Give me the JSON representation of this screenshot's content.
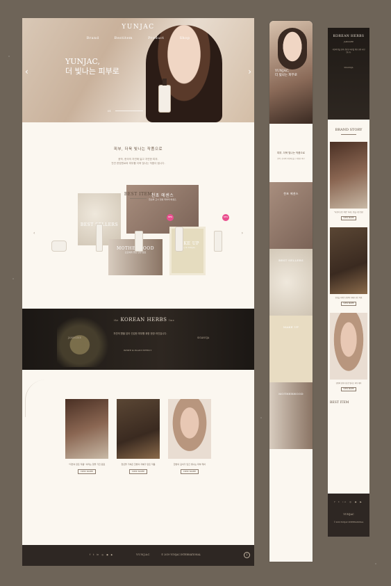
{
  "desktop": {
    "hero": {
      "logo": "YUNJAC",
      "nav": [
        "Brand",
        "Bestitem",
        "Product",
        "Shop"
      ],
      "title_line1": "YUNJAC,",
      "title_line2": "더 빛나는 피부로",
      "page_indicator": "01",
      "prev_icon": "chevron-left-icon",
      "next_icon": "chevron-right-icon"
    },
    "intro": {
      "heading": "피부, 더욱 빛나는 작품으로",
      "body_line1": "윤작, 한국의 자연에 닮고 자연한 피부,",
      "body_line2": "천연 한방원료와 피부를 더욱 빛나는 작품이 됩니다."
    },
    "collage": {
      "best_label": "BEST SELLERS",
      "essence_label": "천초 에센스",
      "essence_sub": "천초와 고시 정성 피부의 에센스",
      "mother_label": "MOTHERHOOD",
      "mother_sub": "산모에게 좋은 한방 원료",
      "makeup_label": "MAKE UP",
      "makeup_sub": "Easy & Simple"
    },
    "herbs": {
      "pre": "the",
      "title": "KOREAN HERBS",
      "post": "line",
      "tag_left": "JAMOOZEE",
      "tag_right": "SIGANGJA",
      "desc": "자연의 향을 담아 건강한 피부를 위한 한방 라인입니다.",
      "button": "WHITE & PLANT EFFECT"
    },
    "story": {
      "cards": [
        {
          "text": "\"자연이 만든 작품\" 이라는 향을 가진 원료",
          "button": "VIEW MORE"
        },
        {
          "text": "천년을 거쳐온 한방의 지혜가 만든 작품",
          "button": "VIEW MORE"
        },
        {
          "text": "한방의 깊이가 담긴 빛나는 피부 케어",
          "button": "VIEW MORE"
        }
      ]
    },
    "best_item": {
      "title": "BEST ITEM",
      "badge_text": "NEW"
    },
    "footer": {
      "social_icons": [
        "f",
        "t",
        "in",
        "◎",
        "◉",
        "▶"
      ],
      "logo": "YUNJAC",
      "copyright": "© 2019 YUNJAC INTERNATIONAL",
      "top_icon": "arrow-up-icon"
    }
  },
  "phone": {
    "hero_text_line1": "YUNJAC,",
    "hero_text_line2": "더 빛나는 피부로",
    "intro_heading": "피부, 더욱 빛나는 작품으로",
    "intro_body": "윤작, 한국의 자연에 닮고 자연한 피부",
    "sections": [
      "천초 에센스",
      "BEST SELLERS",
      "MAKE UP",
      "MOTHERHOOD"
    ]
  },
  "narrow": {
    "herbs_title": "KOREAN HERBS",
    "herbs_tag": "JAMOOZEE",
    "herbs_body": "자연의 향을 담아 건강한 피부를 위한 한방 라인입니다.",
    "herbs_tag2": "SIGANGJA",
    "brand_story": "BRAND STORY",
    "cards": [
      {
        "text": "\"자연이 만든 작품\" 이라는 향을 가진 원료",
        "button": "VIEW MORE"
      },
      {
        "text": "천년을 거쳐온 한방의 지혜가 만든 작품",
        "button": "VIEW MORE"
      },
      {
        "text": "한방의 깊이가 담긴 빛나는 피부 케어",
        "button": "VIEW MORE"
      }
    ],
    "best_item": "BEST ITEM",
    "footer_social": "f t in ◎ ◉ ▶",
    "footer_logo": "YUNJAC",
    "footer_copy": "© 2019 YUNJAC INTERNATIONAL"
  },
  "colors": {
    "background": "#6e6458",
    "cream": "#fbf7f0",
    "dark": "#2e2723",
    "accent_pink": "#e94f8e"
  }
}
